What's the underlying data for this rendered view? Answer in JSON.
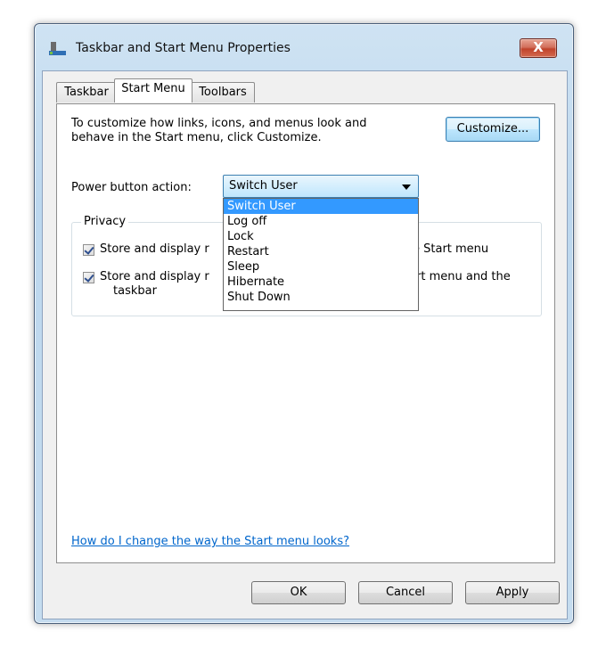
{
  "window": {
    "title": "Taskbar and Start Menu Properties",
    "close_label": "X"
  },
  "tabs": [
    {
      "label": "Taskbar"
    },
    {
      "label": "Start Menu"
    },
    {
      "label": "Toolbars"
    }
  ],
  "start_menu": {
    "intro_line1": "To customize how links, icons, and menus look and",
    "intro_line2": "behave in the Start menu, click Customize.",
    "customize_label": "Customize...",
    "power_label": "Power button action:",
    "power_value": "Switch User",
    "power_options": [
      "Switch User",
      "Log off",
      "Lock",
      "Restart",
      "Sleep",
      "Hibernate",
      "Shut Down"
    ],
    "privacy": {
      "legend": "Privacy",
      "opt1_left": "Store and display r",
      "opt1_right": "e Start menu",
      "opt2_left": "Store and display r",
      "opt2_right": "rt menu and the",
      "opt2_line2": "taskbar"
    },
    "help_link": "How do I change the way the Start menu looks?"
  },
  "buttons": {
    "ok": "OK",
    "cancel": "Cancel",
    "apply": "Apply"
  },
  "colors": {
    "selection": "#3399ff",
    "link": "#0066cc",
    "frame": "#c5dcef"
  }
}
